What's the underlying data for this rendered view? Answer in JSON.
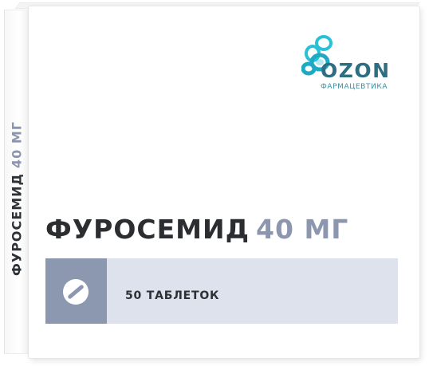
{
  "product": {
    "name": "ФУРОСЕМИД",
    "dose": "40 МГ",
    "count": "50 ТАБЛЕТОК"
  },
  "brand": {
    "name": "OZON",
    "subtitle": "ФАРМАЦЕВТИКА"
  },
  "colors": {
    "band_dark": "#8c97b0",
    "band_light": "#dde2ec",
    "dose_color": "#8c96ae",
    "logo_teal": "#2d6e82",
    "logo_cyan": "#29c1d6"
  },
  "icons": {
    "logo": "ozon-bubbles-logo",
    "tablet": "tablet-icon"
  }
}
